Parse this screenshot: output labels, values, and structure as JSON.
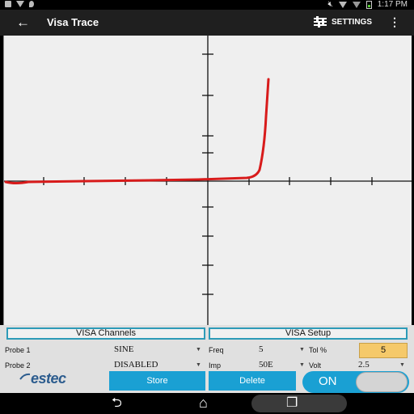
{
  "status": {
    "time": "1:17 PM"
  },
  "app_bar": {
    "title": "Visa Trace",
    "settings_label": "SETTINGS",
    "back_glyph": "←",
    "more_glyph": "⋮"
  },
  "trace": {
    "color": "#d81b1b",
    "axis_color": "#111111",
    "background": "#efefef"
  },
  "channels": {
    "title": "VISA Channels",
    "probe1_label": "Probe 1",
    "probe1_value": "SINE",
    "probe2_label": "Probe 2",
    "probe2_value": "DISABLED"
  },
  "setup": {
    "title": "VISA Setup",
    "freq_label": "Freq",
    "freq_value": "5",
    "tol_label": "Tol %",
    "tol_value": "5",
    "imp_label": "Imp",
    "imp_value": "50E",
    "volt_label": "Volt",
    "volt_value": "2.5"
  },
  "logo_text": "estec",
  "buttons": {
    "store": "Store",
    "delete": "Delete"
  },
  "toggle": {
    "label": "ON",
    "state": "on"
  },
  "nav": {
    "back_glyph": "⮌",
    "home_glyph": "⌂",
    "recent_glyph": "❐"
  },
  "colors": {
    "accent": "#1aa0d3",
    "panel_border": "#2d9bb8",
    "tol_box": "#f5c96a"
  }
}
